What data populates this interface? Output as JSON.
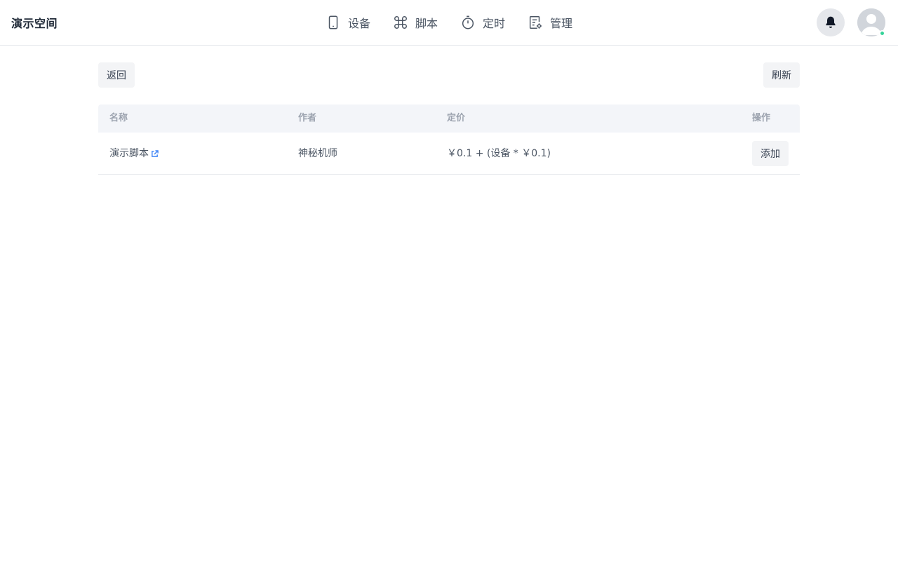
{
  "app": {
    "title": "演示空间"
  },
  "nav": {
    "items": [
      {
        "label": "设备",
        "icon": "phone-icon"
      },
      {
        "label": "脚本",
        "icon": "command-icon"
      },
      {
        "label": "定时",
        "icon": "timer-icon"
      },
      {
        "label": "管理",
        "icon": "settings-doc-icon"
      }
    ]
  },
  "header": {
    "notifications_icon": "bell-icon",
    "avatar_icon": "user-avatar-icon",
    "status_color": "#34d399"
  },
  "toolbar": {
    "back_label": "返回",
    "refresh_label": "刷新"
  },
  "table": {
    "columns": [
      "名称",
      "作者",
      "定价",
      "操作"
    ],
    "rows": [
      {
        "name": "演示脚本",
        "author": "神秘机师",
        "price": "￥0.1 + (设备 * ￥0.1)",
        "action": "添加"
      }
    ]
  }
}
